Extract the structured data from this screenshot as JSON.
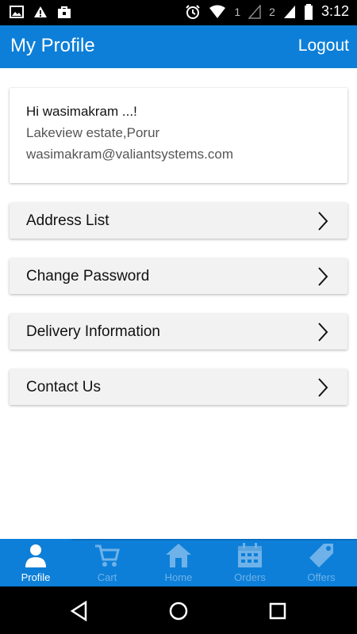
{
  "status_bar": {
    "sim1": "1",
    "sim2": "2",
    "time": "3:12"
  },
  "app_bar": {
    "title": "My Profile",
    "logout_label": "Logout"
  },
  "profile": {
    "greeting": "Hi wasimakram ...!",
    "address": "Lakeview estate,Porur",
    "email": "wasimakram@valiantsystems.com"
  },
  "menu": [
    {
      "label": "Address List"
    },
    {
      "label": "Change Password"
    },
    {
      "label": "Delivery Information"
    },
    {
      "label": "Contact Us"
    }
  ],
  "bottom_nav": [
    {
      "label": "Profile",
      "icon": "person-icon",
      "active": true
    },
    {
      "label": "Cart",
      "icon": "cart-icon",
      "active": false
    },
    {
      "label": "Home",
      "icon": "home-icon",
      "active": false
    },
    {
      "label": "Orders",
      "icon": "calendar-icon",
      "active": false
    },
    {
      "label": "Offers",
      "icon": "tag-icon",
      "active": false
    }
  ],
  "colors": {
    "primary": "#0d7fd8",
    "menu_bg": "#f2f2f2",
    "inactive_tab": "#6fb2e9"
  }
}
